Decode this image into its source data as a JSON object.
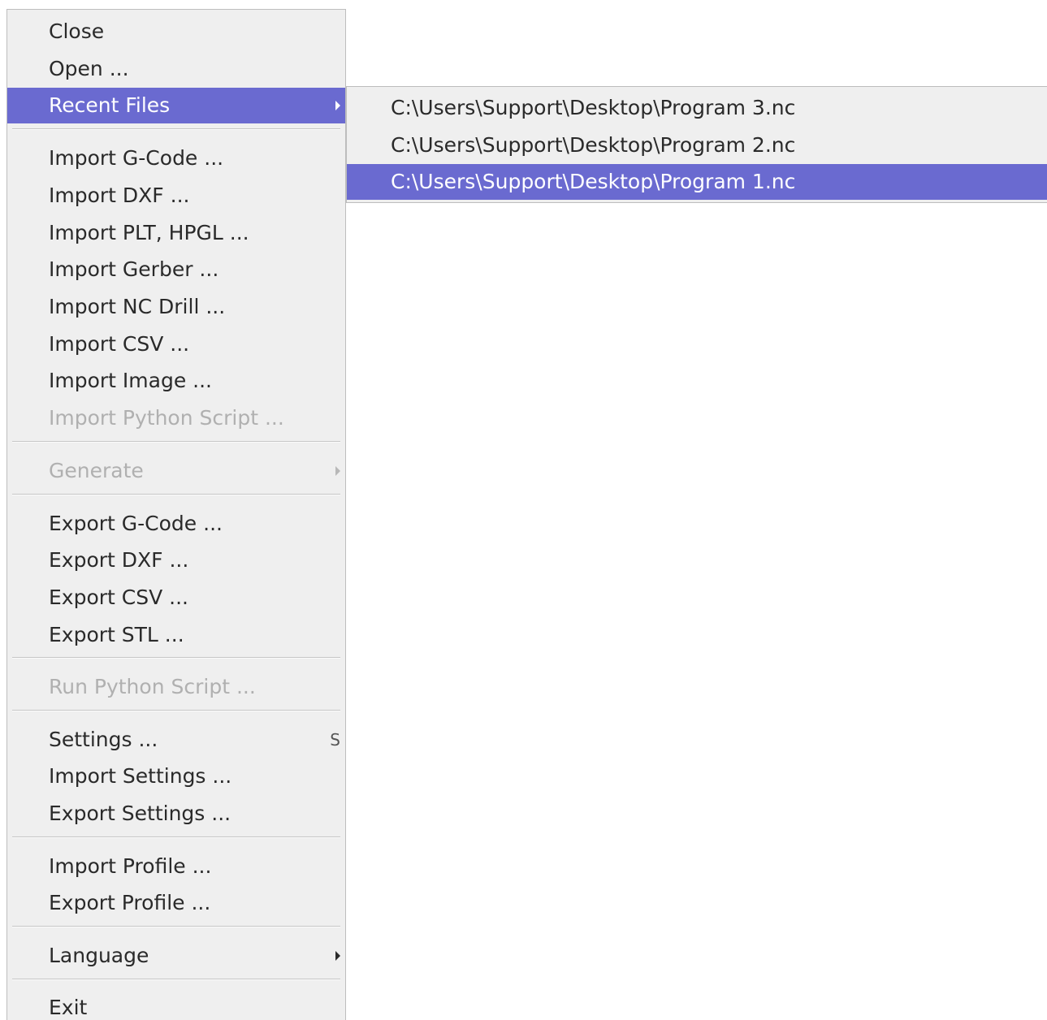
{
  "menu": {
    "close": "Close",
    "open": "Open ...",
    "recent_files": "Recent Files",
    "import_gcode": "Import G-Code ...",
    "import_dxf": "Import DXF ...",
    "import_plt": "Import PLT, HPGL ...",
    "import_gerber": "Import Gerber ...",
    "import_nc_drill": "Import NC Drill ...",
    "import_csv": "Import CSV ...",
    "import_image": "Import Image ...",
    "import_python": "Import Python Script ...",
    "generate": "Generate",
    "export_gcode": "Export G-Code ...",
    "export_dxf": "Export DXF ...",
    "export_csv": "Export CSV ...",
    "export_stl": "Export STL ...",
    "run_python": "Run Python Script ...",
    "settings": "Settings ...",
    "settings_shortcut": "S",
    "import_settings": "Import Settings ...",
    "export_settings": "Export Settings ...",
    "import_profile": "Import Profile ...",
    "export_profile": "Export Profile ...",
    "language": "Language",
    "exit": "Exit"
  },
  "recent_files": {
    "items": [
      "C:\\Users\\Support\\Desktop\\Program 3.nc",
      "C:\\Users\\Support\\Desktop\\Program 2.nc",
      "C:\\Users\\Support\\Desktop\\Program 1.nc"
    ]
  },
  "colors": {
    "highlight": "#6a6ad0",
    "menu_background": "#efefef",
    "disabled_text": "#b0b0b0",
    "text": "#2a2a2a"
  }
}
